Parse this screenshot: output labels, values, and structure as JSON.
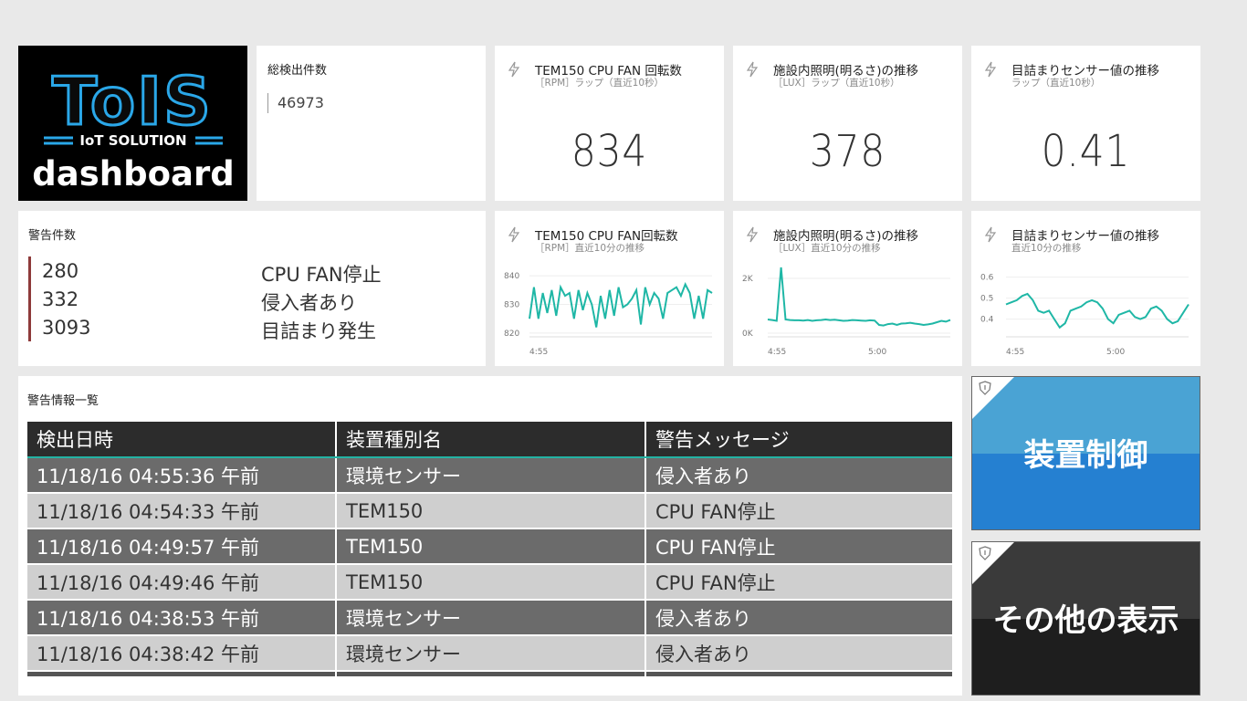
{
  "logo": {
    "brand": "ToIS",
    "tagline": "IoT SOLUTION",
    "label": "dashboard"
  },
  "total": {
    "title": "総検出件数",
    "value": "46973"
  },
  "cards": [
    {
      "title": "TEM150 CPU FAN 回転数",
      "subtitle": "［RPM］ラップ（直近10秒）",
      "value": "834"
    },
    {
      "title": "施設内照明(明るさ)の推移",
      "subtitle": "［LUX］ラップ（直近10秒）",
      "value": "378"
    },
    {
      "title": "目詰まりセンサー値の推移",
      "subtitle": "ラップ（直近10秒）",
      "value": "0.41"
    }
  ],
  "alerts": {
    "title": "警告件数",
    "accent_color": "#8e3a3a",
    "rows": [
      {
        "count": "280",
        "message": "CPU FAN停止"
      },
      {
        "count": "332",
        "message": "侵入者あり"
      },
      {
        "count": "3093",
        "message": "目詰まり発生"
      }
    ]
  },
  "trends": [
    {
      "title": "TEM150 CPU FAN回転数",
      "subtitle": "［RPM］直近10分の推移"
    },
    {
      "title": "施設内照明(明るさ)の推移",
      "subtitle": "［LUX］直近10分の推移"
    },
    {
      "title": "目詰まりセンサー値の推移",
      "subtitle": "直近10分の推移"
    }
  ],
  "chart_data": [
    {
      "type": "line",
      "color": "#1fb7a6",
      "yticks": [
        "840",
        "830",
        "820"
      ],
      "ylim": [
        819,
        841
      ],
      "xticks": [
        "4:55"
      ],
      "values": [
        825,
        836,
        825,
        834,
        827,
        835,
        826,
        836,
        833,
        834,
        825,
        835,
        828,
        834,
        830,
        822,
        833,
        825,
        835,
        826,
        836,
        829,
        830,
        832,
        835,
        823,
        836,
        830,
        834,
        832,
        825,
        834,
        835,
        836,
        833,
        837,
        834,
        825,
        833,
        825,
        835,
        834
      ]
    },
    {
      "type": "line",
      "color": "#1fb7a6",
      "yticks": [
        "2K",
        "0K"
      ],
      "ylim": [
        -100,
        2200
      ],
      "xticks": [
        "4:55",
        "5:00"
      ],
      "values": [
        500,
        480,
        450,
        2400,
        500,
        480,
        470,
        470,
        460,
        480,
        450,
        470,
        480,
        500,
        480,
        490,
        470,
        450,
        460,
        480,
        470,
        460,
        450,
        470,
        460,
        300,
        280,
        330,
        350,
        300,
        350,
        360,
        380,
        350,
        330,
        300,
        320,
        350,
        400,
        450,
        420,
        480
      ]
    },
    {
      "type": "line",
      "color": "#1fb7a6",
      "yticks": [
        "0.6",
        "0.5",
        "0.4"
      ],
      "ylim": [
        0.32,
        0.62
      ],
      "xticks": [
        "4:55",
        "5:00"
      ],
      "values": [
        0.47,
        0.48,
        0.49,
        0.51,
        0.52,
        0.49,
        0.44,
        0.43,
        0.44,
        0.4,
        0.36,
        0.38,
        0.44,
        0.45,
        0.46,
        0.48,
        0.49,
        0.48,
        0.45,
        0.4,
        0.38,
        0.42,
        0.43,
        0.44,
        0.41,
        0.4,
        0.41,
        0.45,
        0.46,
        0.44,
        0.4,
        0.38,
        0.39,
        0.43,
        0.47
      ]
    }
  ],
  "table": {
    "title": "警告情報一覧",
    "headers": [
      "検出日時",
      "装置種別名",
      "警告メッセージ"
    ],
    "rows": [
      [
        "11/18/16 04:55:36 午前",
        "環境センサー",
        "侵入者あり"
      ],
      [
        "11/18/16 04:54:33 午前",
        "TEM150",
        "CPU FAN停止"
      ],
      [
        "11/18/16 04:49:57 午前",
        "TEM150",
        "CPU FAN停止"
      ],
      [
        "11/18/16 04:49:46 午前",
        "TEM150",
        "CPU FAN停止"
      ],
      [
        "11/18/16 04:38:53 午前",
        "環境センサー",
        "侵入者あり"
      ],
      [
        "11/18/16 04:38:42 午前",
        "環境センサー",
        "侵入者あり"
      ]
    ]
  },
  "buttons": {
    "control": {
      "label": "装置制御",
      "color_top": "#4aa3d4",
      "color_bottom": "#2580d1"
    },
    "more": {
      "label": "その他の表示",
      "color_top": "#3a3a3a",
      "color_bottom": "#1e1e1e"
    }
  }
}
